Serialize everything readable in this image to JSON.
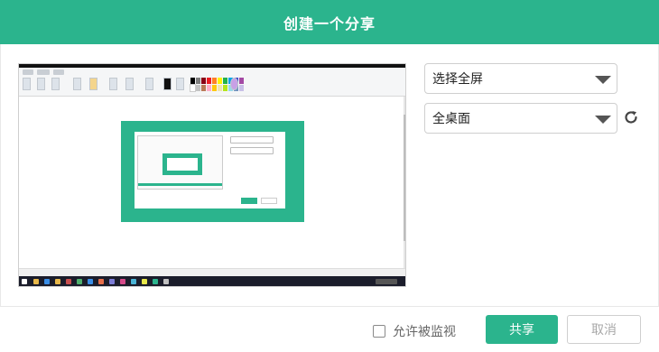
{
  "dialog": {
    "title": "创建一个分享"
  },
  "controls": {
    "capture_mode": "选择全屏",
    "screen_select": "全桌面"
  },
  "footer": {
    "allow_monitor_label": "允许被监视",
    "share_label": "共享",
    "cancel_label": "取消"
  },
  "icons": {
    "dropdown": "chevron-down-icon",
    "refresh": "refresh-icon"
  },
  "colors": {
    "accent": "#2bb48d",
    "preview_taskbar": "#1b1d2b"
  }
}
